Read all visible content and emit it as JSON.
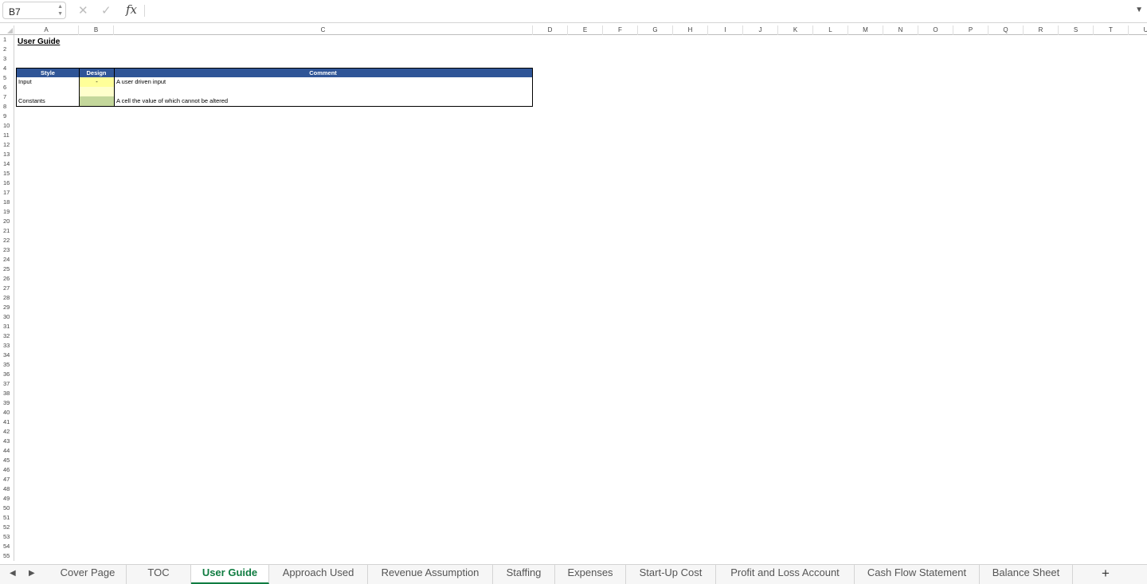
{
  "formula_bar": {
    "name_box": "B7",
    "fx_label": "fx",
    "formula": ""
  },
  "sheet": {
    "columns": [
      "A",
      "B",
      "C",
      "D",
      "E",
      "F",
      "G",
      "H",
      "I",
      "J",
      "K",
      "L",
      "M",
      "N",
      "O",
      "P",
      "Q",
      "R",
      "S",
      "T",
      "U"
    ],
    "row_count": 55,
    "title": "User Guide",
    "table": {
      "headers": [
        "Style",
        "Design",
        "Comment"
      ],
      "rows": [
        {
          "style": "Input",
          "design": "-",
          "comment": "A user driven input"
        },
        {
          "style": "Constants",
          "design": "",
          "comment": "A cell the value of which cannot be altered"
        }
      ]
    },
    "colors": {
      "header_bg": "#2f5597",
      "input_fill": "#ffff99",
      "constant_fill": "#c4d79b"
    }
  },
  "tabs": [
    {
      "label": "Cover Page",
      "active": false
    },
    {
      "label": "TOC",
      "active": false
    },
    {
      "label": "User Guide",
      "active": true
    },
    {
      "label": "Approach Used",
      "active": false
    },
    {
      "label": "Revenue Assumption",
      "active": false
    },
    {
      "label": "Staffing",
      "active": false
    },
    {
      "label": "Expenses",
      "active": false
    },
    {
      "label": "Start-Up Cost",
      "active": false
    },
    {
      "label": "Profit and Loss Account",
      "active": false
    },
    {
      "label": "Cash Flow Statement",
      "active": false
    },
    {
      "label": "Balance Sheet",
      "active": false
    }
  ],
  "tab_controls": {
    "prev": "◀",
    "next": "▶",
    "add": "+"
  },
  "accent": "#107c41"
}
